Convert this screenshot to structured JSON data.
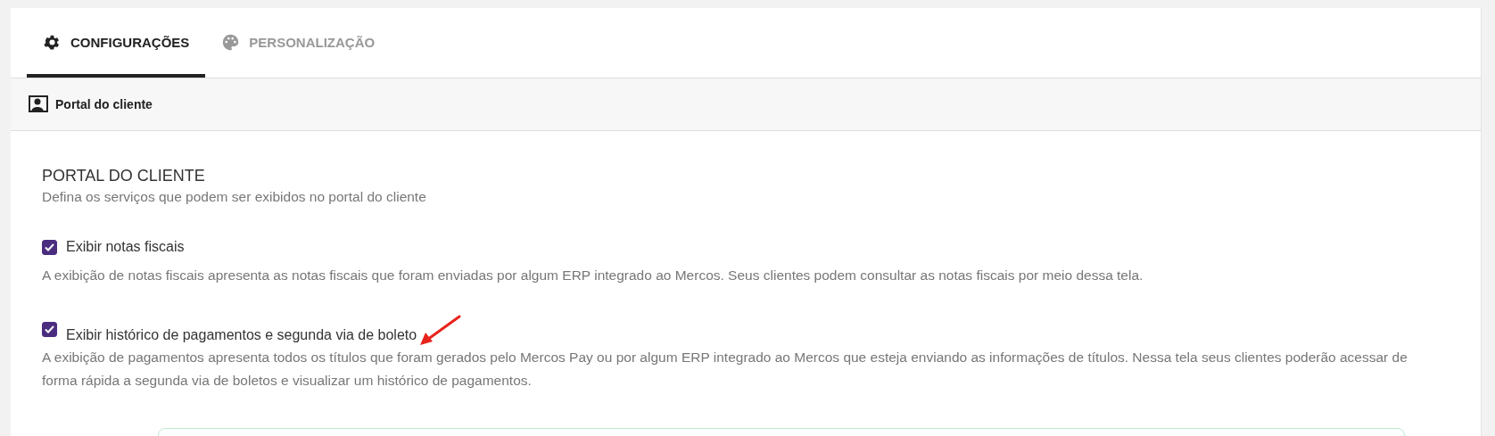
{
  "tabs": [
    {
      "label": "CONFIGURAÇÕES",
      "kind": "settings",
      "selected": true
    },
    {
      "label": "PERSONALIZAÇÃO",
      "kind": "palette",
      "selected": false
    }
  ],
  "section_header": {
    "title": "Portal do cliente"
  },
  "content": {
    "title": "PORTAL DO CLIENTE",
    "subtitle": "Defina os serviços que podem ser exibidos no portal do cliente",
    "options": [
      {
        "label": "Exibir notas fiscais",
        "checked": true,
        "description": "A exibição de notas fiscais apresenta as notas fiscais que foram enviadas por algum ERP integrado ao Mercos. Seus clientes podem consultar as notas fiscais por meio dessa tela."
      },
      {
        "label": "Exibir histórico de pagamentos e segunda via de boleto",
        "checked": true,
        "annotated": true,
        "description": "A exibição de pagamentos apresenta todos os títulos que foram gerados pelo Mercos Pay ou por algum ERP integrado ao Mercos que esteja enviando as informações de títulos. Nessa tela seus clientes poderão acessar de forma rápida a segunda via de boletos e visualizar um histórico de pagamentos."
      }
    ]
  }
}
